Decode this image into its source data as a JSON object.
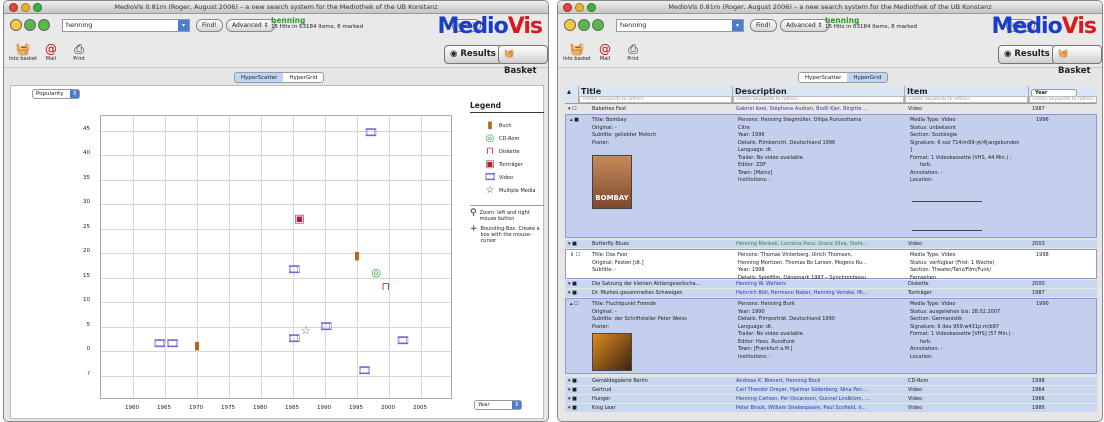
{
  "window_title": "MedioVis 0.81m (Roger, August 2006) – a new search system for the Mediothek of the UB Konstanz",
  "search": {
    "value": "henning",
    "find": "Find!",
    "advanced": "Advanced ⇕",
    "help": "Help?"
  },
  "hits": {
    "query": "henning",
    "text": "15 Hits in 63184 Items, 8 marked"
  },
  "logo": {
    "m": "Medio",
    "v": "Vis"
  },
  "tools": [
    "Into basket",
    "Mail",
    "Print"
  ],
  "buttons": {
    "results": "Results",
    "basket": "Basket"
  },
  "tabs": {
    "scatter": "HyperScatter",
    "grid": "HyperGrid"
  },
  "colors": {
    "accent": "#1a3cc8",
    "query_green": "#2a9a2a",
    "selected_row": "#c4cfee",
    "tab_on": "#bcd6f4"
  },
  "scatter": {
    "y_selector": "Popularity",
    "x_selector": "Year",
    "legend_title": "Legend",
    "legend": [
      {
        "icon": "book-icon",
        "label": "Buch"
      },
      {
        "icon": "cdrom-icon",
        "label": "CD-Rom"
      },
      {
        "icon": "diskette-icon",
        "label": "Diskette"
      },
      {
        "icon": "tape-icon",
        "label": "Tonträger"
      },
      {
        "icon": "video-icon",
        "label": "Video"
      },
      {
        "icon": "star-icon",
        "label": "Multiple Media"
      }
    ],
    "zoom_hint": "Zoom: left and right mouse button",
    "bbox_hint": "Bounding-Box: Create a box with the mouse-cursor"
  },
  "chart_data": {
    "type": "scatter",
    "xlabel": "",
    "ylabel": "",
    "xlim": [
      1955,
      2010
    ],
    "ylim": [
      -10,
      48
    ],
    "x_ticks": [
      1960,
      1965,
      1970,
      1975,
      1980,
      1985,
      1990,
      1995,
      2000,
      2005
    ],
    "y_ticks": [
      45,
      40,
      35,
      30,
      25,
      20,
      15,
      10,
      5,
      0,
      "?"
    ],
    "points": [
      {
        "x": 1997,
        "y": 44.5,
        "media": "Video"
      },
      {
        "x": 1986,
        "y": 27,
        "media": "Tonträger"
      },
      {
        "x": 1995,
        "y": 19.5,
        "media": "Buch"
      },
      {
        "x": 1998,
        "y": 16,
        "media": "CD-Rom"
      },
      {
        "x": 1985,
        "y": 16.5,
        "media": "Video"
      },
      {
        "x": 1999.5,
        "y": 13,
        "media": "Diskette"
      },
      {
        "x": 1987,
        "y": 4,
        "media": "Multiple Media"
      },
      {
        "x": 1990,
        "y": 5,
        "media": "Video"
      },
      {
        "x": 1985,
        "y": 2.5,
        "media": "Video"
      },
      {
        "x": 2002,
        "y": 2,
        "media": "Video"
      },
      {
        "x": 1964,
        "y": 1.5,
        "media": "Video"
      },
      {
        "x": 1966,
        "y": 1.5,
        "media": "Video"
      },
      {
        "x": 1970,
        "y": 1,
        "media": "Buch"
      },
      {
        "x": 1996,
        "y": -4,
        "media": "Video"
      }
    ]
  },
  "grid": {
    "columns": [
      "Title",
      "Description",
      "Item",
      "Year"
    ],
    "filter_placeholder": "<enter keywords to refine>",
    "rows_top": [
      {
        "title": "Babettes Fest",
        "desc": "Gabriel Axel, Stéphane Audran, Bodil Kjer, Birgitte ...",
        "item": "Video",
        "year": "1987"
      }
    ],
    "detail1": {
      "left": [
        "Title: Bombay",
        "Original: -",
        "Subtitle: geliebter Moloch",
        "Poster:"
      ],
      "mid": [
        "Persons: Henning Stegmüller, Dilipa Purusottama",
        "Citre",
        "Year: 1996",
        "Details: Filmbericht, Deutschland 1996",
        "Language: dt.",
        "Trailer: No video available.",
        "Editor: ZDF",
        "Town: [Mainz]",
        "Institutions: -"
      ],
      "right": [
        "Media Type: Video",
        "Status: unbekannt",
        "Section: Soziologie",
        "Signature: 6 soz 714/m99-yt/4[angebunden",
        "]",
        "Format: 1 Videokassette (VHS, 44 Min.) :",
        "farb.",
        "Annotation: -",
        "Location:"
      ],
      "year": "1996",
      "poster_text": "BOMBAY"
    },
    "row_butterfly": {
      "title": "Butterfly Blues",
      "desc": "Henning Mankell, Lucrécia Paco, Graca Silva, Stefa...",
      "item": "Video",
      "year": "2003"
    },
    "detail2": {
      "left": [
        "Title: Das Fest",
        "Original: Festen [dt.]",
        "Subtitle: -"
      ],
      "mid": [
        "Persons: Thomas Vinterberg, Ulrich Thomsen,",
        "Henning Moritzen, Thomas Bo Larsen, Mogens Ru...",
        "Year: 1998",
        "Details: Spielfilm, Dänemark 1997 – Synchronfassu"
      ],
      "right": [
        "Media Type: Video",
        "Status: verfügbar (Frist: 1 Woche)",
        "Section: Theater/Tanz/Film/Funk/",
        "Fernsehen"
      ],
      "year": "1998"
    },
    "rows_mid": [
      {
        "title": "Die Satzung der kleinen Aktiengesellscha...",
        "desc": "Henning W. Wahlers",
        "item": "Diskette",
        "year": "2000"
      },
      {
        "title": "Dr. Murkes gesammeltes Schweigen",
        "desc": "Heinrich Böll, Hermann Naber, Henning Venske, Mi...",
        "item": "Tonträger",
        "year": "1987"
      }
    ],
    "detail3": {
      "left": [
        "Title: Fluchtpunkt Fremde",
        "Original: -",
        "Subtitle: der Schriftsteller Peter Weiss",
        "Poster:"
      ],
      "mid": [
        "Persons: Henning Burk",
        "Year: 1990",
        "Details: Filmporträt, Deutschland 1990",
        "Language: dt.",
        "Trailer: No video available.",
        "Editor: Hess. Rundfunk",
        "Town: [Frankfurt a.M.]",
        "Institutions: -"
      ],
      "right": [
        "Media Type: Video",
        "Status: ausgeliehen bis: 28.02.2007",
        "Section: Germanistik",
        "Signature: 6 deu 959:w431p:m/b97",
        "Format: 1 Videokassette [VHS] (57 Min.) :",
        "farb.",
        "Annotation: -",
        "Location:"
      ],
      "year": "1990"
    },
    "rows_bottom": [
      {
        "title": "Gemäldegalerie Berlin",
        "desc": "Andreas K. Bienert, Henning Bock",
        "item": "CD-Rom",
        "year": "1998"
      },
      {
        "title": "Gertrud",
        "desc": "Carl Theodor Dreyer, Hjalmar Söderberg, Nina Pen...",
        "item": "Video",
        "year": "1964"
      },
      {
        "title": "Hunger",
        "desc": "Henning Carlsen, Per Oscarsson, Gunnel Lindblom, ...",
        "item": "Video",
        "year": "1966"
      },
      {
        "title": "King Lear",
        "desc": "Peter Brook, William Shakespeare, Paul Scofield, Ir...",
        "item": "Video",
        "year": "1986"
      }
    ],
    "year_selector": "Year"
  }
}
